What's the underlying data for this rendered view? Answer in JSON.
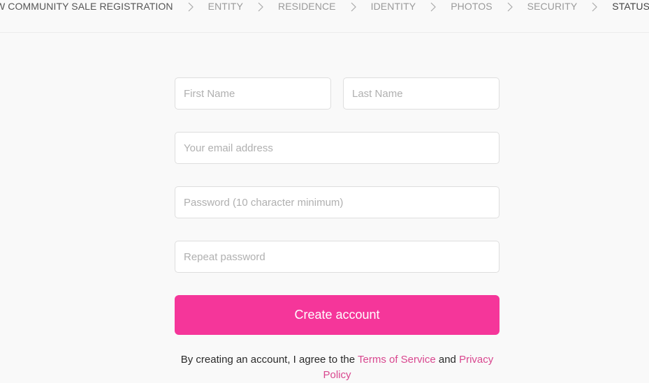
{
  "header": {
    "breadcrumb": [
      {
        "label": "W COMMUNITY SALE REGISTRATION",
        "state": "first"
      },
      {
        "label": "ENTITY",
        "state": "upcoming"
      },
      {
        "label": "RESIDENCE",
        "state": "upcoming"
      },
      {
        "label": "IDENTITY",
        "state": "upcoming"
      },
      {
        "label": "PHOTOS",
        "state": "upcoming"
      },
      {
        "label": "SECURITY",
        "state": "upcoming"
      },
      {
        "label": "STATUS",
        "state": "current"
      }
    ],
    "separator_icon": "chevron-right-icon"
  },
  "form": {
    "first_name": {
      "value": "",
      "placeholder": "First Name"
    },
    "last_name": {
      "value": "",
      "placeholder": "Last Name"
    },
    "email": {
      "value": "",
      "placeholder": "Your email address"
    },
    "password": {
      "value": "",
      "placeholder": "Password (10 character minimum)"
    },
    "repeat_password": {
      "value": "",
      "placeholder": "Repeat password"
    },
    "submit_label": "Create account"
  },
  "legal": {
    "prefix": "By creating an account, I agree to the ",
    "terms_link": "Terms of Service",
    "conjunction": " and ",
    "privacy_link": "Privacy Policy"
  },
  "colors": {
    "accent": "#f5369a",
    "link": "#d9478f",
    "background": "#f9f9f9"
  }
}
